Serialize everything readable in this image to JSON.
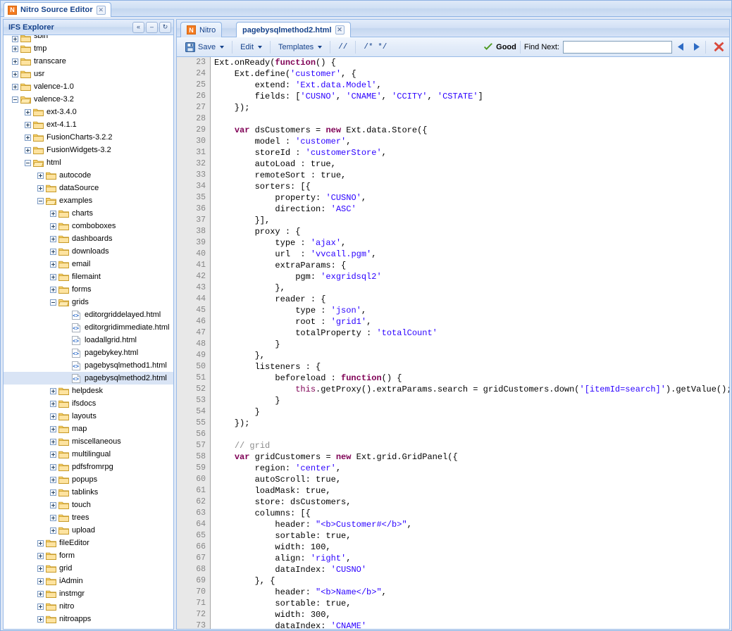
{
  "window": {
    "app_tab_label": "Nitro Source Editor",
    "app_logo_letter": "N",
    "close_glyph": "☒"
  },
  "explorer": {
    "title": "IFS Explorer",
    "buttons": [
      {
        "name": "collapse-all-button",
        "glyph": "«"
      },
      {
        "name": "minimize-button",
        "glyph": "–"
      },
      {
        "name": "refresh-button",
        "glyph": "↻"
      }
    ],
    "tree": [
      {
        "label": "sbin",
        "depth": 0,
        "type": "folder",
        "state": "closed",
        "clipped": true
      },
      {
        "label": "tmp",
        "depth": 0,
        "type": "folder",
        "state": "closed"
      },
      {
        "label": "transcare",
        "depth": 0,
        "type": "folder",
        "state": "closed"
      },
      {
        "label": "usr",
        "depth": 0,
        "type": "folder",
        "state": "closed"
      },
      {
        "label": "valence-1.0",
        "depth": 0,
        "type": "folder",
        "state": "closed"
      },
      {
        "label": "valence-3.2",
        "depth": 0,
        "type": "folder",
        "state": "open"
      },
      {
        "label": "ext-3.4.0",
        "depth": 1,
        "type": "folder",
        "state": "closed"
      },
      {
        "label": "ext-4.1.1",
        "depth": 1,
        "type": "folder",
        "state": "closed"
      },
      {
        "label": "FusionCharts-3.2.2",
        "depth": 1,
        "type": "folder",
        "state": "closed"
      },
      {
        "label": "FusionWidgets-3.2",
        "depth": 1,
        "type": "folder",
        "state": "closed"
      },
      {
        "label": "html",
        "depth": 1,
        "type": "folder",
        "state": "open"
      },
      {
        "label": "autocode",
        "depth": 2,
        "type": "folder",
        "state": "closed"
      },
      {
        "label": "dataSource",
        "depth": 2,
        "type": "folder",
        "state": "closed"
      },
      {
        "label": "examples",
        "depth": 2,
        "type": "folder",
        "state": "open"
      },
      {
        "label": "charts",
        "depth": 3,
        "type": "folder",
        "state": "closed"
      },
      {
        "label": "comboboxes",
        "depth": 3,
        "type": "folder",
        "state": "closed"
      },
      {
        "label": "dashboards",
        "depth": 3,
        "type": "folder",
        "state": "closed"
      },
      {
        "label": "downloads",
        "depth": 3,
        "type": "folder",
        "state": "closed"
      },
      {
        "label": "email",
        "depth": 3,
        "type": "folder",
        "state": "closed"
      },
      {
        "label": "filemaint",
        "depth": 3,
        "type": "folder",
        "state": "closed"
      },
      {
        "label": "forms",
        "depth": 3,
        "type": "folder",
        "state": "closed"
      },
      {
        "label": "grids",
        "depth": 3,
        "type": "folder",
        "state": "open"
      },
      {
        "label": "editorgriddelayed.html",
        "depth": 4,
        "type": "file"
      },
      {
        "label": "editorgridimmediate.html",
        "depth": 4,
        "type": "file"
      },
      {
        "label": "loadallgrid.html",
        "depth": 4,
        "type": "file"
      },
      {
        "label": "pagebykey.html",
        "depth": 4,
        "type": "file"
      },
      {
        "label": "pagebysqlmethod1.html",
        "depth": 4,
        "type": "file"
      },
      {
        "label": "pagebysqlmethod2.html",
        "depth": 4,
        "type": "file",
        "selected": true
      },
      {
        "label": "helpdesk",
        "depth": 3,
        "type": "folder",
        "state": "closed"
      },
      {
        "label": "ifsdocs",
        "depth": 3,
        "type": "folder",
        "state": "closed"
      },
      {
        "label": "layouts",
        "depth": 3,
        "type": "folder",
        "state": "closed"
      },
      {
        "label": "map",
        "depth": 3,
        "type": "folder",
        "state": "closed"
      },
      {
        "label": "miscellaneous",
        "depth": 3,
        "type": "folder",
        "state": "closed"
      },
      {
        "label": "multilingual",
        "depth": 3,
        "type": "folder",
        "state": "closed"
      },
      {
        "label": "pdfsfromrpg",
        "depth": 3,
        "type": "folder",
        "state": "closed"
      },
      {
        "label": "popups",
        "depth": 3,
        "type": "folder",
        "state": "closed"
      },
      {
        "label": "tablinks",
        "depth": 3,
        "type": "folder",
        "state": "closed"
      },
      {
        "label": "touch",
        "depth": 3,
        "type": "folder",
        "state": "closed"
      },
      {
        "label": "trees",
        "depth": 3,
        "type": "folder",
        "state": "closed"
      },
      {
        "label": "upload",
        "depth": 3,
        "type": "folder",
        "state": "closed"
      },
      {
        "label": "fileEditor",
        "depth": 2,
        "type": "folder",
        "state": "closed"
      },
      {
        "label": "form",
        "depth": 2,
        "type": "folder",
        "state": "closed"
      },
      {
        "label": "grid",
        "depth": 2,
        "type": "folder",
        "state": "closed"
      },
      {
        "label": "iAdmin",
        "depth": 2,
        "type": "folder",
        "state": "closed"
      },
      {
        "label": "instmgr",
        "depth": 2,
        "type": "folder",
        "state": "closed"
      },
      {
        "label": "nitro",
        "depth": 2,
        "type": "folder",
        "state": "closed"
      },
      {
        "label": "nitroapps",
        "depth": 2,
        "type": "folder",
        "state": "closed"
      }
    ]
  },
  "editor": {
    "tabs": [
      {
        "label": "Nitro",
        "active": false,
        "logo": "N"
      },
      {
        "label": "pagebysqlmethod2.html",
        "active": true,
        "closable": true
      }
    ],
    "toolbar": {
      "save_label": "Save",
      "edit_label": "Edit",
      "templates_label": "Templates",
      "line_comment_label": "//",
      "block_comment_label": "/* */",
      "status_label": "Good",
      "find_label": "Find Next:",
      "find_value": "",
      "find_placeholder": "",
      "prev_glyph": "◀",
      "next_glyph": "▶",
      "close_glyph": "✖"
    },
    "first_line_number": 23,
    "code_lines": [
      [
        [
          "p",
          "Ext.onReady("
        ],
        [
          "k",
          "function"
        ],
        [
          "p",
          "() {"
        ]
      ],
      [
        [
          "p",
          "    Ext.define("
        ],
        [
          "s",
          "'customer'"
        ],
        [
          "p",
          ", {"
        ]
      ],
      [
        [
          "p",
          "        extend: "
        ],
        [
          "s",
          "'Ext.data.Model'"
        ],
        [
          "p",
          ","
        ]
      ],
      [
        [
          "p",
          "        fields: ["
        ],
        [
          "s",
          "'CUSNO'"
        ],
        [
          "p",
          ", "
        ],
        [
          "s",
          "'CNAME'"
        ],
        [
          "p",
          ", "
        ],
        [
          "s",
          "'CCITY'"
        ],
        [
          "p",
          ", "
        ],
        [
          "s",
          "'CSTATE'"
        ],
        [
          "p",
          "]"
        ]
      ],
      [
        [
          "p",
          "    });"
        ]
      ],
      [
        [
          "p",
          ""
        ]
      ],
      [
        [
          "p",
          "    "
        ],
        [
          "k",
          "var"
        ],
        [
          "p",
          " dsCustomers = "
        ],
        [
          "k",
          "new"
        ],
        [
          "p",
          " Ext.data.Store({"
        ]
      ],
      [
        [
          "p",
          "        model : "
        ],
        [
          "s",
          "'customer'"
        ],
        [
          "p",
          ","
        ]
      ],
      [
        [
          "p",
          "        storeId : "
        ],
        [
          "s",
          "'customerStore'"
        ],
        [
          "p",
          ","
        ]
      ],
      [
        [
          "p",
          "        autoLoad : true,"
        ]
      ],
      [
        [
          "p",
          "        remoteSort : true,"
        ]
      ],
      [
        [
          "p",
          "        sorters: [{"
        ]
      ],
      [
        [
          "p",
          "            property: "
        ],
        [
          "s",
          "'CUSNO'"
        ],
        [
          "p",
          ","
        ]
      ],
      [
        [
          "p",
          "            direction: "
        ],
        [
          "s",
          "'ASC'"
        ]
      ],
      [
        [
          "p",
          "        }],"
        ]
      ],
      [
        [
          "p",
          "        proxy : {"
        ]
      ],
      [
        [
          "p",
          "            type : "
        ],
        [
          "s",
          "'ajax'"
        ],
        [
          "p",
          ","
        ]
      ],
      [
        [
          "p",
          "            url  : "
        ],
        [
          "s",
          "'vvcall.pgm'"
        ],
        [
          "p",
          ","
        ]
      ],
      [
        [
          "p",
          "            extraParams: {"
        ]
      ],
      [
        [
          "p",
          "                pgm: "
        ],
        [
          "s",
          "'exgridsql2'"
        ]
      ],
      [
        [
          "p",
          "            },"
        ]
      ],
      [
        [
          "p",
          "            reader : {"
        ]
      ],
      [
        [
          "p",
          "                type : "
        ],
        [
          "s",
          "'json'"
        ],
        [
          "p",
          ","
        ]
      ],
      [
        [
          "p",
          "                root : "
        ],
        [
          "s",
          "'grid1'"
        ],
        [
          "p",
          ","
        ]
      ],
      [
        [
          "p",
          "                totalProperty : "
        ],
        [
          "s",
          "'totalCount'"
        ]
      ],
      [
        [
          "p",
          "            }"
        ]
      ],
      [
        [
          "p",
          "        },"
        ]
      ],
      [
        [
          "p",
          "        listeners : {"
        ]
      ],
      [
        [
          "p",
          "            beforeload : "
        ],
        [
          "k",
          "function"
        ],
        [
          "p",
          "() {"
        ]
      ],
      [
        [
          "p",
          "                "
        ],
        [
          "t",
          "this"
        ],
        [
          "p",
          ".getProxy().extraParams.search = gridCustomers.down("
        ],
        [
          "s",
          "'[itemId=search]'"
        ],
        [
          "p",
          ").getValue();"
        ]
      ],
      [
        [
          "p",
          "            }"
        ]
      ],
      [
        [
          "p",
          "        }"
        ]
      ],
      [
        [
          "p",
          "    });"
        ]
      ],
      [
        [
          "p",
          ""
        ]
      ],
      [
        [
          "p",
          "    "
        ],
        [
          "c",
          "// grid"
        ]
      ],
      [
        [
          "p",
          "    "
        ],
        [
          "k",
          "var"
        ],
        [
          "p",
          " gridCustomers = "
        ],
        [
          "k",
          "new"
        ],
        [
          "p",
          " Ext.grid.GridPanel({"
        ]
      ],
      [
        [
          "p",
          "        region: "
        ],
        [
          "s",
          "'center'"
        ],
        [
          "p",
          ","
        ]
      ],
      [
        [
          "p",
          "        autoScroll: true,"
        ]
      ],
      [
        [
          "p",
          "        loadMask: true,"
        ]
      ],
      [
        [
          "p",
          "        store: dsCustomers,"
        ]
      ],
      [
        [
          "p",
          "        columns: [{"
        ]
      ],
      [
        [
          "p",
          "            header: "
        ],
        [
          "s",
          "\"<b>Customer#</b>\""
        ],
        [
          "p",
          ","
        ]
      ],
      [
        [
          "p",
          "            sortable: true,"
        ]
      ],
      [
        [
          "p",
          "            width: 100,"
        ]
      ],
      [
        [
          "p",
          "            align: "
        ],
        [
          "s",
          "'right'"
        ],
        [
          "p",
          ","
        ]
      ],
      [
        [
          "p",
          "            dataIndex: "
        ],
        [
          "s",
          "'CUSNO'"
        ]
      ],
      [
        [
          "p",
          "        }, {"
        ]
      ],
      [
        [
          "p",
          "            header: "
        ],
        [
          "s",
          "\"<b>Name</b>\""
        ],
        [
          "p",
          ","
        ]
      ],
      [
        [
          "p",
          "            sortable: true,"
        ]
      ],
      [
        [
          "p",
          "            width: 300,"
        ]
      ],
      [
        [
          "p",
          "            dataIndex: "
        ],
        [
          "s",
          "'CNAME'"
        ]
      ]
    ]
  },
  "colors": {
    "chrome_blue": "#99bbe8",
    "title_text": "#15428b",
    "logo_orange": "#f47b20",
    "selection": "#d9e4f5",
    "gutter": "#e8e8e8",
    "keyword": "#7f0055",
    "string": "#2a00ff",
    "comment": "#8c8c8c",
    "status_green": "#4d9a20",
    "close_red": "#d94a3c"
  }
}
